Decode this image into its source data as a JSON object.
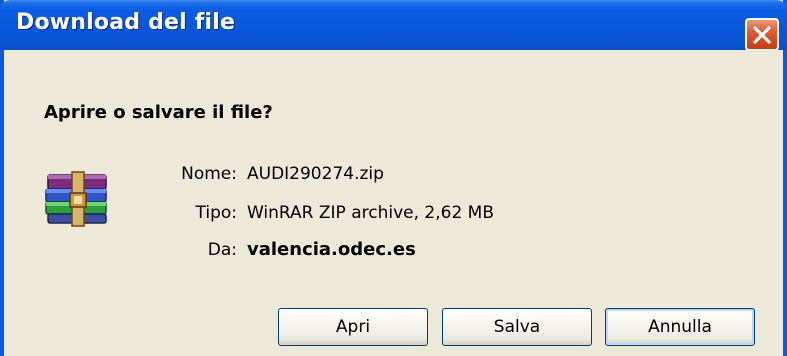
{
  "window": {
    "title": "Download del file"
  },
  "dialog": {
    "question": "Aprire o salvare il file?",
    "icon": "winrar-archive-icon",
    "fields": {
      "name_label": "Nome:",
      "name_value": "AUDI290274.zip",
      "type_label": "Tipo:",
      "type_value": "WinRAR ZIP archive, 2,62 MB",
      "from_label": "Da:",
      "from_value": "valencia.odec.es"
    }
  },
  "buttons": {
    "open_label": "Apri",
    "save_label": "Salva",
    "cancel_label": "Annulla"
  },
  "colors": {
    "titlebar": "#0a57d8",
    "dialog_bg": "#ece9d8",
    "close_button": "#d44a22",
    "button_border": "#003c74"
  }
}
